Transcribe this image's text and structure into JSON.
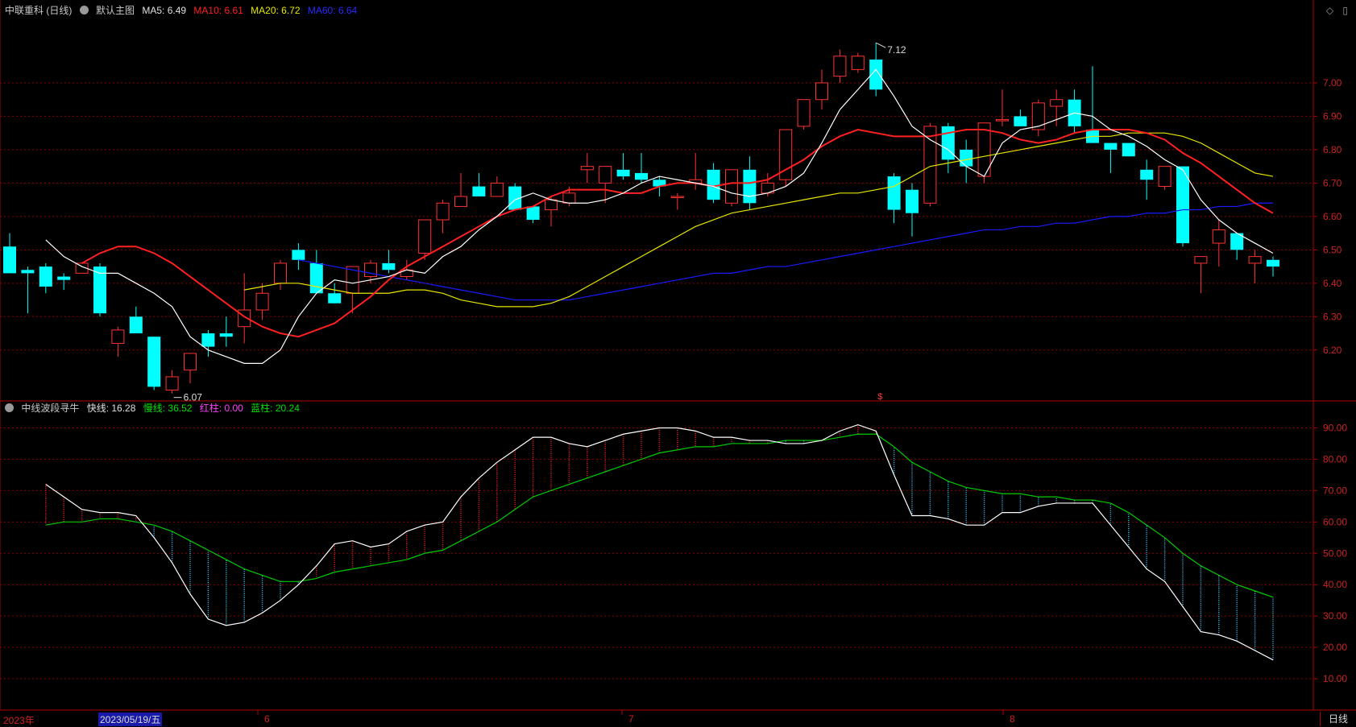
{
  "header": {
    "stock_name": "中联重科 (日线)",
    "main_chart_label": "默认主图",
    "ma5": "MA5: 6.49",
    "ma10": "MA10: 6.61",
    "ma20": "MA20: 6.72",
    "ma60": "MA60: 6.64"
  },
  "sub_header": {
    "indicator_name": "中线波段寻牛",
    "fast_line": "快线: 16.28",
    "slow_line": "慢线: 36.52",
    "red_col": "红柱: 0.00",
    "blue_col": "蓝柱: 20.24"
  },
  "annotations": {
    "high_label": "7.12",
    "low_label": "6.07",
    "marker": "$"
  },
  "xaxis": {
    "year": "2023年",
    "selected_date": "2023/05/19/五",
    "month_6": "6",
    "month_7": "7",
    "month_8": "8"
  },
  "period_button": "日线",
  "top_icons": [
    "◇",
    "▯"
  ],
  "colors": {
    "up": "#ff3232",
    "down": "#00ffff",
    "ma5": "#ffffff",
    "ma10": "#ff2020",
    "ma20": "#e6e600",
    "ma60": "#1a1aff",
    "slow": "#00cc00",
    "fast": "#ffffff",
    "grid": "#8b0000"
  },
  "chart_data": [
    {
      "type": "candlestick",
      "ylim": [
        6.05,
        7.2
      ],
      "y_ticks": [
        "7.00",
        "6.90",
        "6.80",
        "6.70",
        "6.60",
        "6.50",
        "6.40",
        "6.30",
        "6.20"
      ],
      "candles": [
        [
          6.51,
          6.55,
          6.43,
          6.43
        ],
        [
          6.44,
          6.45,
          6.31,
          6.43
        ],
        [
          6.45,
          6.46,
          6.37,
          6.39
        ],
        [
          6.42,
          6.43,
          6.38,
          6.41
        ],
        [
          6.43,
          6.46,
          6.43,
          6.46
        ],
        [
          6.45,
          6.46,
          6.3,
          6.31
        ],
        [
          6.22,
          6.27,
          6.18,
          6.26
        ],
        [
          6.3,
          6.33,
          6.25,
          6.25
        ],
        [
          6.24,
          6.24,
          6.08,
          6.09
        ],
        [
          6.08,
          6.14,
          6.07,
          6.12
        ],
        [
          6.14,
          6.19,
          6.1,
          6.19
        ],
        [
          6.25,
          6.26,
          6.18,
          6.21
        ],
        [
          6.25,
          6.3,
          6.21,
          6.24
        ],
        [
          6.27,
          6.43,
          6.22,
          6.32
        ],
        [
          6.32,
          6.4,
          6.29,
          6.37
        ],
        [
          6.4,
          6.47,
          6.38,
          6.46
        ],
        [
          6.5,
          6.52,
          6.44,
          6.47
        ],
        [
          6.46,
          6.5,
          6.37,
          6.37
        ],
        [
          6.37,
          6.4,
          6.34,
          6.34
        ],
        [
          6.37,
          6.45,
          6.31,
          6.45
        ],
        [
          6.42,
          6.47,
          6.4,
          6.46
        ],
        [
          6.46,
          6.5,
          6.43,
          6.44
        ],
        [
          6.42,
          6.47,
          6.41,
          6.44
        ],
        [
          6.49,
          6.59,
          6.47,
          6.59
        ],
        [
          6.59,
          6.65,
          6.55,
          6.64
        ],
        [
          6.63,
          6.73,
          6.63,
          6.66
        ],
        [
          6.69,
          6.73,
          6.66,
          6.66
        ],
        [
          6.66,
          6.72,
          6.66,
          6.7
        ],
        [
          6.69,
          6.7,
          6.62,
          6.62
        ],
        [
          6.63,
          6.63,
          6.58,
          6.59
        ],
        [
          6.62,
          6.66,
          6.57,
          6.65
        ],
        [
          6.64,
          6.69,
          6.63,
          6.67
        ],
        [
          6.74,
          6.79,
          6.7,
          6.75
        ],
        [
          6.7,
          6.75,
          6.64,
          6.75
        ],
        [
          6.74,
          6.79,
          6.71,
          6.72
        ],
        [
          6.73,
          6.79,
          6.7,
          6.71
        ],
        [
          6.71,
          6.72,
          6.66,
          6.69
        ],
        [
          6.66,
          6.67,
          6.62,
          6.66
        ],
        [
          6.7,
          6.79,
          6.68,
          6.71
        ],
        [
          6.74,
          6.76,
          6.64,
          6.65
        ],
        [
          6.64,
          6.74,
          6.63,
          6.74
        ],
        [
          6.74,
          6.78,
          6.62,
          6.64
        ],
        [
          6.67,
          6.73,
          6.66,
          6.7
        ],
        [
          6.71,
          6.86,
          6.69,
          6.86
        ],
        [
          6.87,
          6.95,
          6.86,
          6.95
        ],
        [
          6.95,
          7.04,
          6.92,
          7.0
        ],
        [
          7.02,
          7.1,
          7.0,
          7.08
        ],
        [
          7.04,
          7.09,
          7.03,
          7.08
        ],
        [
          7.07,
          7.12,
          6.96,
          6.98
        ],
        [
          6.72,
          6.73,
          6.58,
          6.62
        ],
        [
          6.68,
          6.7,
          6.54,
          6.61
        ],
        [
          6.64,
          6.88,
          6.63,
          6.87
        ],
        [
          6.87,
          6.88,
          6.73,
          6.77
        ],
        [
          6.8,
          6.83,
          6.7,
          6.75
        ],
        [
          6.72,
          6.88,
          6.7,
          6.88
        ],
        [
          6.89,
          6.98,
          6.87,
          6.89
        ],
        [
          6.9,
          6.92,
          6.87,
          6.87
        ],
        [
          6.86,
          6.95,
          6.84,
          6.94
        ],
        [
          6.93,
          6.98,
          6.87,
          6.95
        ],
        [
          6.95,
          6.98,
          6.85,
          6.87
        ],
        [
          6.86,
          7.05,
          6.82,
          6.82
        ],
        [
          6.82,
          6.82,
          6.73,
          6.8
        ],
        [
          6.82,
          6.82,
          6.78,
          6.78
        ],
        [
          6.74,
          6.77,
          6.65,
          6.71
        ],
        [
          6.69,
          6.75,
          6.68,
          6.75
        ],
        [
          6.75,
          6.75,
          6.51,
          6.52
        ],
        [
          6.46,
          6.48,
          6.37,
          6.48
        ],
        [
          6.52,
          6.59,
          6.45,
          6.56
        ],
        [
          6.55,
          6.55,
          6.47,
          6.5
        ],
        [
          6.46,
          6.5,
          6.4,
          6.48
        ],
        [
          6.47,
          6.48,
          6.42,
          6.45
        ]
      ],
      "ma5": [
        6.53,
        6.48,
        6.45,
        6.43,
        6.43,
        6.4,
        6.37,
        6.33,
        6.24,
        6.2,
        6.18,
        6.16,
        6.16,
        6.2,
        6.3,
        6.37,
        6.41,
        6.4,
        6.41,
        6.42,
        6.44,
        6.43,
        6.48,
        6.51,
        6.56,
        6.6,
        6.65,
        6.67,
        6.65,
        6.64,
        6.64,
        6.65,
        6.67,
        6.7,
        6.72,
        6.71,
        6.7,
        6.69,
        6.67,
        6.66,
        6.67,
        6.69,
        6.73,
        6.82,
        6.92,
        6.98,
        7.04,
        6.96,
        6.87,
        6.83,
        6.8,
        6.75,
        6.72,
        6.82,
        6.86,
        6.87,
        6.89,
        6.91,
        6.9,
        6.86,
        6.84,
        6.81,
        6.77,
        6.74,
        6.65,
        6.59,
        6.55,
        6.52,
        6.49
      ],
      "ma10": [
        6.46,
        6.49,
        6.51,
        6.51,
        6.49,
        6.46,
        6.42,
        6.38,
        6.34,
        6.3,
        6.27,
        6.25,
        6.24,
        6.26,
        6.28,
        6.32,
        6.36,
        6.41,
        6.45,
        6.48,
        6.51,
        6.54,
        6.57,
        6.6,
        6.62,
        6.63,
        6.66,
        6.68,
        6.68,
        6.68,
        6.67,
        6.67,
        6.69,
        6.7,
        6.7,
        6.69,
        6.7,
        6.7,
        6.71,
        6.74,
        6.77,
        6.81,
        6.84,
        6.86,
        6.85,
        6.84,
        6.84,
        6.84,
        6.85,
        6.86,
        6.86,
        6.85,
        6.83,
        6.82,
        6.83,
        6.85,
        6.86,
        6.86,
        6.86,
        6.85,
        6.83,
        6.79,
        6.76,
        6.72,
        6.68,
        6.64,
        6.61
      ],
      "ma20": [
        6.38,
        6.39,
        6.4,
        6.4,
        6.39,
        6.38,
        6.37,
        6.37,
        6.37,
        6.38,
        6.38,
        6.37,
        6.35,
        6.34,
        6.33,
        6.33,
        6.33,
        6.34,
        6.36,
        6.39,
        6.42,
        6.45,
        6.48,
        6.51,
        6.54,
        6.57,
        6.59,
        6.61,
        6.62,
        6.63,
        6.64,
        6.65,
        6.66,
        6.67,
        6.67,
        6.68,
        6.69,
        6.72,
        6.75,
        6.76,
        6.77,
        6.78,
        6.79,
        6.8,
        6.81,
        6.82,
        6.83,
        6.84,
        6.84,
        6.85,
        6.85,
        6.85,
        6.84,
        6.82,
        6.79,
        6.76,
        6.73,
        6.72
      ],
      "ma60": [
        6.47,
        6.46,
        6.45,
        6.44,
        6.43,
        6.42,
        6.41,
        6.4,
        6.39,
        6.38,
        6.37,
        6.36,
        6.35,
        6.35,
        6.35,
        6.35,
        6.36,
        6.37,
        6.38,
        6.39,
        6.4,
        6.41,
        6.42,
        6.43,
        6.43,
        6.44,
        6.45,
        6.45,
        6.46,
        6.47,
        6.48,
        6.49,
        6.5,
        6.51,
        6.52,
        6.53,
        6.54,
        6.55,
        6.56,
        6.56,
        6.57,
        6.57,
        6.58,
        6.58,
        6.59,
        6.6,
        6.6,
        6.61,
        6.61,
        6.62,
        6.62,
        6.63,
        6.63,
        6.64,
        6.64
      ]
    },
    {
      "type": "line",
      "ylim": [
        0,
        95
      ],
      "y_ticks": [
        "90.00",
        "80.00",
        "70.00",
        "60.00",
        "50.00",
        "40.00",
        "30.00",
        "20.00",
        "10.00"
      ],
      "fast": [
        72,
        68,
        64,
        63,
        63,
        62,
        55,
        47,
        37,
        29,
        27,
        28,
        31,
        35,
        40,
        46,
        53,
        54,
        52,
        53,
        57,
        59,
        60,
        68,
        74,
        79,
        83,
        87,
        87,
        85,
        84,
        86,
        88,
        89,
        90,
        90,
        89,
        87,
        87,
        86,
        86,
        85,
        85,
        86,
        89,
        91,
        89,
        75,
        62,
        62,
        61,
        59,
        59,
        63,
        63,
        65,
        66,
        66,
        66,
        59,
        52,
        45,
        41,
        33,
        25,
        24,
        22,
        19,
        16
      ],
      "slow": [
        59,
        60,
        60,
        61,
        61,
        60,
        59,
        57,
        54,
        51,
        48,
        45,
        43,
        41,
        41,
        42,
        44,
        45,
        46,
        47,
        48,
        50,
        51,
        54,
        57,
        60,
        64,
        68,
        70,
        72,
        74,
        76,
        78,
        80,
        82,
        83,
        84,
        84,
        85,
        85,
        85,
        86,
        86,
        86,
        87,
        88,
        88,
        84,
        79,
        76,
        73,
        71,
        70,
        69,
        69,
        68,
        68,
        67,
        67,
        66,
        63,
        59,
        55,
        50,
        46,
        43,
        40,
        38,
        36
      ]
    }
  ]
}
